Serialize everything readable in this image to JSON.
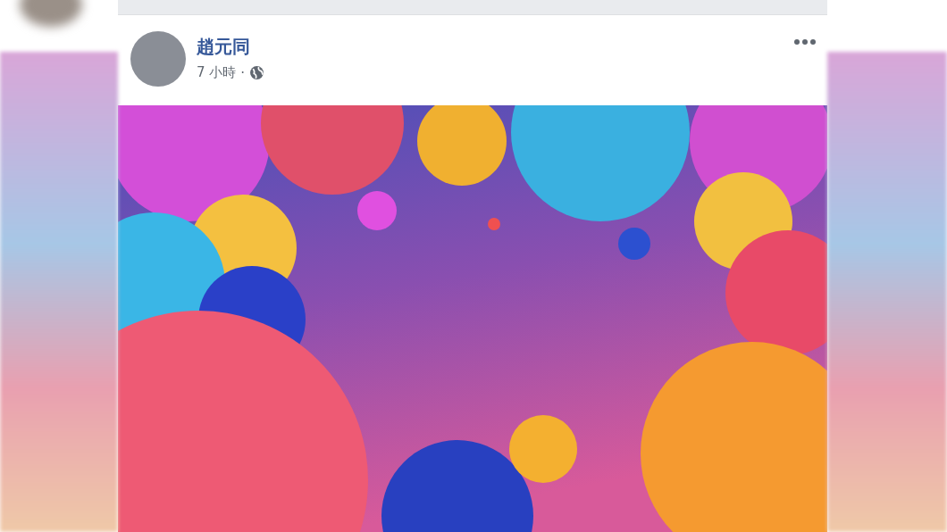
{
  "post": {
    "author": "趙元同",
    "time": "7 小時",
    "separator": "·"
  }
}
